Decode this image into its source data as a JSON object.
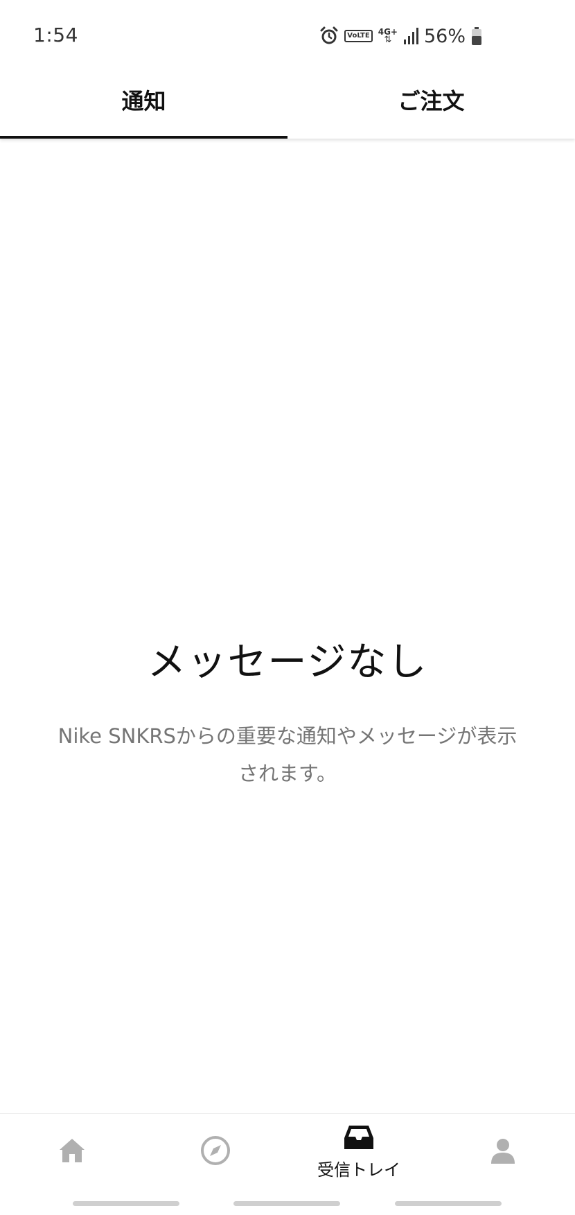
{
  "status_bar": {
    "time": "1:54",
    "volte_label": "VoLTE",
    "network_label": "4G+",
    "battery_percent": "56%",
    "battery_level": 0.56,
    "icons": [
      "alarm-icon",
      "volte-icon",
      "network-4g-icon",
      "signal-icon",
      "battery-icon"
    ]
  },
  "tabs": [
    {
      "label": "通知",
      "active": true
    },
    {
      "label": "ご注文",
      "active": false
    }
  ],
  "empty_state": {
    "title": "メッセージなし",
    "description": "Nike SNKRSからの重要な通知やメッセージが表示されます。"
  },
  "bottom_nav": {
    "items": [
      {
        "icon": "home-icon",
        "label": "",
        "active": false
      },
      {
        "icon": "compass-icon",
        "label": "",
        "active": false
      },
      {
        "icon": "inbox-icon",
        "label": "受信トレイ",
        "active": true
      },
      {
        "icon": "profile-icon",
        "label": "",
        "active": false
      }
    ]
  },
  "colors": {
    "text_primary": "#111111",
    "text_secondary": "#757575",
    "icon_inactive": "#b0b0b0",
    "indicator": "#cfcfcf"
  }
}
